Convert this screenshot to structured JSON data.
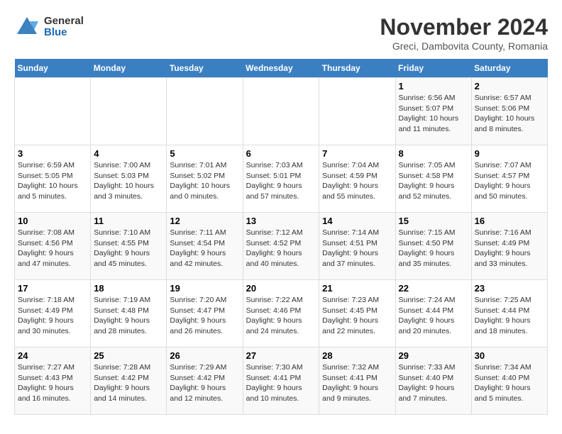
{
  "header": {
    "logo_general": "General",
    "logo_blue": "Blue",
    "month_title": "November 2024",
    "location": "Greci, Dambovita County, Romania"
  },
  "weekdays": [
    "Sunday",
    "Monday",
    "Tuesday",
    "Wednesday",
    "Thursday",
    "Friday",
    "Saturday"
  ],
  "weeks": [
    [
      {
        "day": "",
        "info": ""
      },
      {
        "day": "",
        "info": ""
      },
      {
        "day": "",
        "info": ""
      },
      {
        "day": "",
        "info": ""
      },
      {
        "day": "",
        "info": ""
      },
      {
        "day": "1",
        "info": "Sunrise: 6:56 AM\nSunset: 5:07 PM\nDaylight: 10 hours and 11 minutes."
      },
      {
        "day": "2",
        "info": "Sunrise: 6:57 AM\nSunset: 5:06 PM\nDaylight: 10 hours and 8 minutes."
      }
    ],
    [
      {
        "day": "3",
        "info": "Sunrise: 6:59 AM\nSunset: 5:05 PM\nDaylight: 10 hours and 5 minutes."
      },
      {
        "day": "4",
        "info": "Sunrise: 7:00 AM\nSunset: 5:03 PM\nDaylight: 10 hours and 3 minutes."
      },
      {
        "day": "5",
        "info": "Sunrise: 7:01 AM\nSunset: 5:02 PM\nDaylight: 10 hours and 0 minutes."
      },
      {
        "day": "6",
        "info": "Sunrise: 7:03 AM\nSunset: 5:01 PM\nDaylight: 9 hours and 57 minutes."
      },
      {
        "day": "7",
        "info": "Sunrise: 7:04 AM\nSunset: 4:59 PM\nDaylight: 9 hours and 55 minutes."
      },
      {
        "day": "8",
        "info": "Sunrise: 7:05 AM\nSunset: 4:58 PM\nDaylight: 9 hours and 52 minutes."
      },
      {
        "day": "9",
        "info": "Sunrise: 7:07 AM\nSunset: 4:57 PM\nDaylight: 9 hours and 50 minutes."
      }
    ],
    [
      {
        "day": "10",
        "info": "Sunrise: 7:08 AM\nSunset: 4:56 PM\nDaylight: 9 hours and 47 minutes."
      },
      {
        "day": "11",
        "info": "Sunrise: 7:10 AM\nSunset: 4:55 PM\nDaylight: 9 hours and 45 minutes."
      },
      {
        "day": "12",
        "info": "Sunrise: 7:11 AM\nSunset: 4:54 PM\nDaylight: 9 hours and 42 minutes."
      },
      {
        "day": "13",
        "info": "Sunrise: 7:12 AM\nSunset: 4:52 PM\nDaylight: 9 hours and 40 minutes."
      },
      {
        "day": "14",
        "info": "Sunrise: 7:14 AM\nSunset: 4:51 PM\nDaylight: 9 hours and 37 minutes."
      },
      {
        "day": "15",
        "info": "Sunrise: 7:15 AM\nSunset: 4:50 PM\nDaylight: 9 hours and 35 minutes."
      },
      {
        "day": "16",
        "info": "Sunrise: 7:16 AM\nSunset: 4:49 PM\nDaylight: 9 hours and 33 minutes."
      }
    ],
    [
      {
        "day": "17",
        "info": "Sunrise: 7:18 AM\nSunset: 4:49 PM\nDaylight: 9 hours and 30 minutes."
      },
      {
        "day": "18",
        "info": "Sunrise: 7:19 AM\nSunset: 4:48 PM\nDaylight: 9 hours and 28 minutes."
      },
      {
        "day": "19",
        "info": "Sunrise: 7:20 AM\nSunset: 4:47 PM\nDaylight: 9 hours and 26 minutes."
      },
      {
        "day": "20",
        "info": "Sunrise: 7:22 AM\nSunset: 4:46 PM\nDaylight: 9 hours and 24 minutes."
      },
      {
        "day": "21",
        "info": "Sunrise: 7:23 AM\nSunset: 4:45 PM\nDaylight: 9 hours and 22 minutes."
      },
      {
        "day": "22",
        "info": "Sunrise: 7:24 AM\nSunset: 4:44 PM\nDaylight: 9 hours and 20 minutes."
      },
      {
        "day": "23",
        "info": "Sunrise: 7:25 AM\nSunset: 4:44 PM\nDaylight: 9 hours and 18 minutes."
      }
    ],
    [
      {
        "day": "24",
        "info": "Sunrise: 7:27 AM\nSunset: 4:43 PM\nDaylight: 9 hours and 16 minutes."
      },
      {
        "day": "25",
        "info": "Sunrise: 7:28 AM\nSunset: 4:42 PM\nDaylight: 9 hours and 14 minutes."
      },
      {
        "day": "26",
        "info": "Sunrise: 7:29 AM\nSunset: 4:42 PM\nDaylight: 9 hours and 12 minutes."
      },
      {
        "day": "27",
        "info": "Sunrise: 7:30 AM\nSunset: 4:41 PM\nDaylight: 9 hours and 10 minutes."
      },
      {
        "day": "28",
        "info": "Sunrise: 7:32 AM\nSunset: 4:41 PM\nDaylight: 9 hours and 9 minutes."
      },
      {
        "day": "29",
        "info": "Sunrise: 7:33 AM\nSunset: 4:40 PM\nDaylight: 9 hours and 7 minutes."
      },
      {
        "day": "30",
        "info": "Sunrise: 7:34 AM\nSunset: 4:40 PM\nDaylight: 9 hours and 5 minutes."
      }
    ]
  ]
}
